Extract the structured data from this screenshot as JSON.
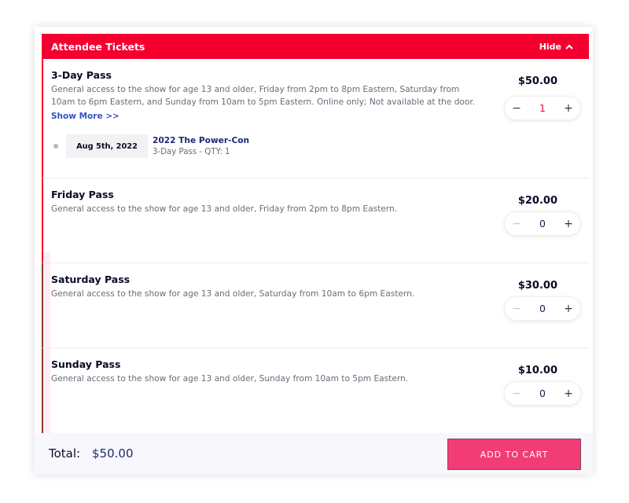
{
  "header": {
    "title": "Attendee Tickets",
    "hide_label": "Hide",
    "hide_icon": "chevron-up-icon"
  },
  "tickets": [
    {
      "name": "3-Day Pass",
      "description": "General access to the show for age 13 and older, Friday from 2pm to 8pm Eastern, Saturday from 10am to 6pm Eastern, and Sunday from 10am to 5pm Eastern. Online only; Not available at the door.",
      "price": "$50.00",
      "quantity": "1",
      "show_more": "Show More >>",
      "event": {
        "date": "Aug 5th, 2022",
        "title": "2022 The Power-Con",
        "detail": "3-Day Pass - QTY: 1"
      }
    },
    {
      "name": "Friday Pass",
      "description": "General access to the show for age 13 and older, Friday from 2pm to 8pm Eastern.",
      "price": "$20.00",
      "quantity": "0"
    },
    {
      "name": "Saturday Pass",
      "description": "General access to the show for age 13 and older, Saturday from 10am to 6pm Eastern.",
      "price": "$30.00",
      "quantity": "0"
    },
    {
      "name": "Sunday Pass",
      "description": "General access to the show for age 13 and older, Sunday from 10am to 5pm Eastern.",
      "price": "$10.00",
      "quantity": "0"
    }
  ],
  "stepper": {
    "minus": "−",
    "plus": "+"
  },
  "footer": {
    "total_label": "Total:",
    "total_value": "$50.00",
    "add_to_cart": "ADD TO CART"
  },
  "colors": {
    "accent": "#f5002e",
    "button": "#f23c76",
    "link": "#3353c4",
    "navy": "#1c2a78"
  }
}
